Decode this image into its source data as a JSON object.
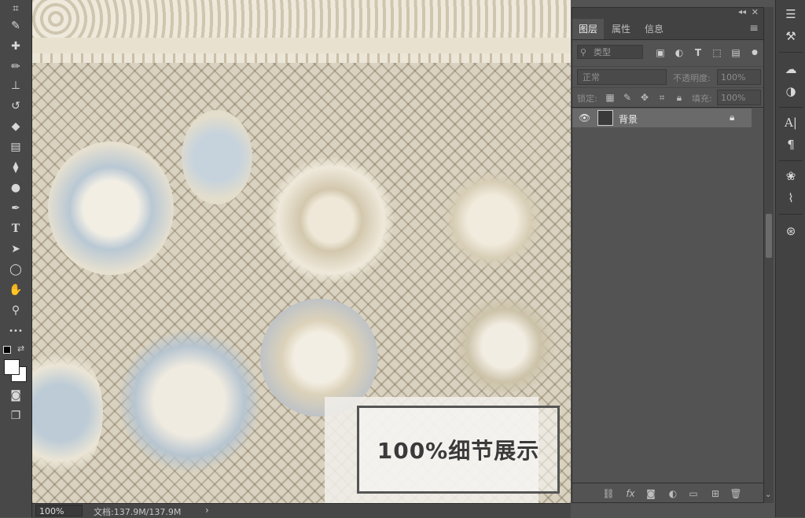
{
  "tools": [
    {
      "name": "crop-icon",
      "glyph": "⌗"
    },
    {
      "name": "eyedropper-icon",
      "glyph": "✎"
    },
    {
      "name": "healing-brush-icon",
      "glyph": "✚"
    },
    {
      "name": "brush-icon",
      "glyph": "✏"
    },
    {
      "name": "clone-stamp-icon",
      "glyph": "⊥"
    },
    {
      "name": "history-brush-icon",
      "glyph": "↺"
    },
    {
      "name": "eraser-icon",
      "glyph": "◆"
    },
    {
      "name": "gradient-icon",
      "glyph": "▤"
    },
    {
      "name": "blur-icon",
      "glyph": "⧫"
    },
    {
      "name": "dodge-icon",
      "glyph": "●"
    },
    {
      "name": "pen-icon",
      "glyph": "✒"
    },
    {
      "name": "type-tool-icon",
      "glyph": "T"
    },
    {
      "name": "path-selection-icon",
      "glyph": "➤"
    },
    {
      "name": "ellipse-icon",
      "glyph": "◯"
    },
    {
      "name": "hand-icon",
      "glyph": "✋"
    },
    {
      "name": "zoom-icon",
      "glyph": "⚲"
    },
    {
      "name": "more-tools-icon",
      "glyph": "•••"
    }
  ],
  "canvas": {
    "detail_label": "100%细节展示"
  },
  "status": {
    "zoom": "100%",
    "doc_info": "文档:137.9M/137.9M",
    "arrow": "›"
  },
  "panel": {
    "collapse": "◂◂",
    "close": "✕",
    "tabs": [
      "图层",
      "属性",
      "信息"
    ],
    "menu": "≡",
    "filter_placeholder": "类型",
    "blend_mode": "正常",
    "opacity_label": "不透明度:",
    "opacity_value": "100%",
    "lock_label": "锁定:",
    "fill_label": "填充:",
    "fill_value": "100%",
    "layers": [
      {
        "name": "背景",
        "visible": true,
        "locked": true
      }
    ]
  },
  "colors": {
    "accent": "#6a6a6a",
    "panel_bg": "#535353",
    "toolbar_bg": "#484848"
  }
}
